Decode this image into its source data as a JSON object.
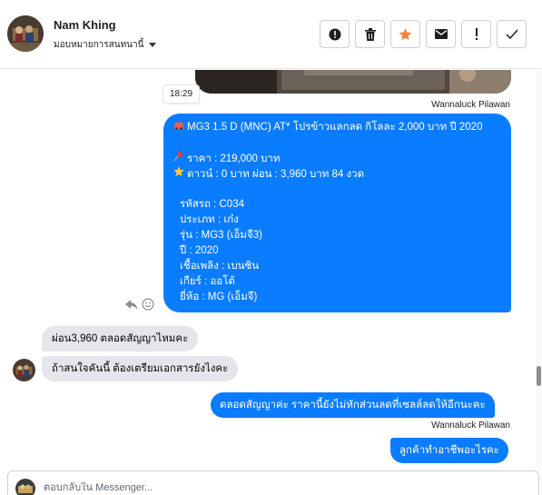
{
  "header": {
    "contact_name": "Nam Khing",
    "assign_label": "มอบหมายการสนทนานี้",
    "toolbar": [
      {
        "name": "report-spam",
        "icon": "exclamation-circle-icon"
      },
      {
        "name": "delete",
        "icon": "trash-icon"
      },
      {
        "name": "star",
        "icon": "star-icon"
      },
      {
        "name": "mark-unread",
        "icon": "envelope-icon"
      },
      {
        "name": "follow-up",
        "icon": "exclamation-icon"
      },
      {
        "name": "mark-done",
        "icon": "checkmark-icon"
      }
    ]
  },
  "conversation": {
    "timestamp": "18:29",
    "messages": {
      "m1_sender": "Wannaluck Pilawan",
      "m1_lines": {
        "title": "MG3 1.5 D (MNC) AT* โปรข้าวแลกลด กิโลละ 2,000 บาท ปี 2020",
        "price": "ราคา : 219,000 บาท",
        "down": "ดาวน์ : 0 บาท ผ่อน : 3,960 บาท 84 งวด",
        "code": "รหัสรถ : C034",
        "type": "ประเภท : เก๋ง",
        "model": "รุ่น : MG3 (เอ็มจี3)",
        "year": "ปี : 2020",
        "fuel": "เชื้อเพลิง : เบนซิน",
        "gear": "เกียร์ : ออโต้",
        "brand": "ยี่ห้อ : MG (เอ็มจี)"
      },
      "in1": "ผ่อน3,960 ตลอดสัญญาไหมคะ",
      "in2": "ถ้าสนใจคันนี้ ต้องเตรียมเอกสารยังไงคะ",
      "out2": "ตลอดสัญญาค่ะ  ราคานี้ยังไม่หักส่วนลดที่เซลล์ลดให้อีกนะคะ",
      "out2_sender": "Wannaluck Pilawan",
      "out3": "ลูกค้าทำอาชีพอะไรคะ"
    }
  },
  "composer": {
    "placeholder": "ตอบกลับใน Messenger..."
  },
  "colors": {
    "outgoing_bubble": "#0a7cff",
    "incoming_bubble": "#e4e6eb",
    "star_accent": "#f5833b"
  }
}
